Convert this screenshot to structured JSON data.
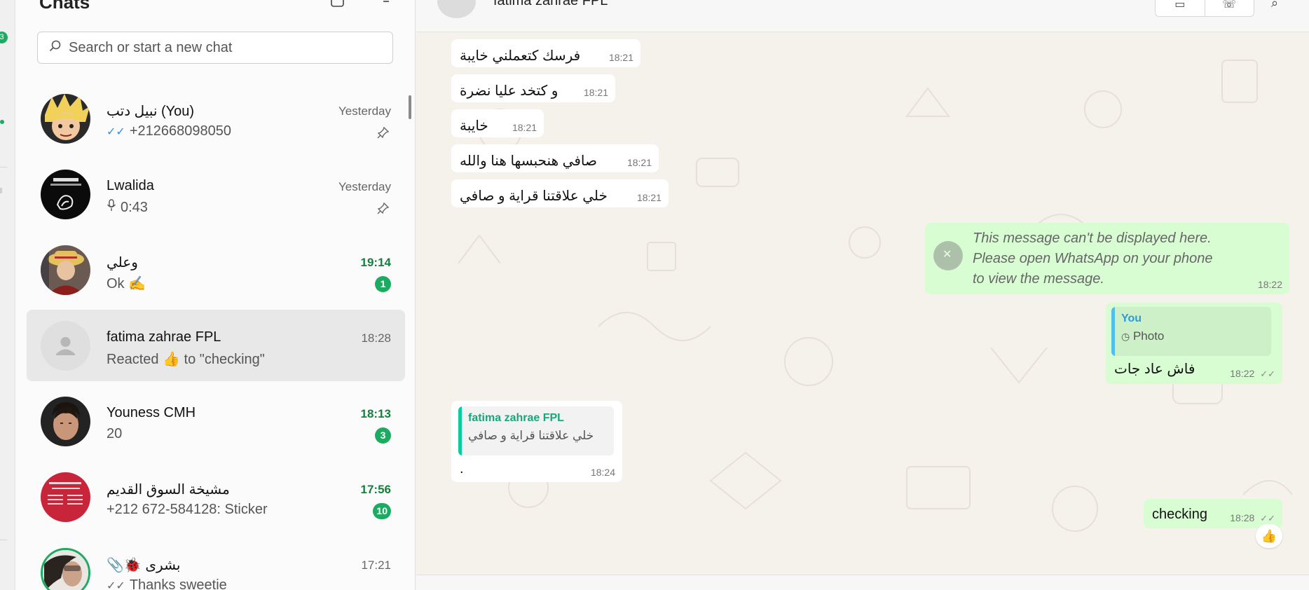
{
  "rail": {
    "badge": "3"
  },
  "sidebar": {
    "title": "Chats",
    "search": {
      "placeholder": "Search or start a new chat",
      "value": ""
    },
    "chats": [
      {
        "name": "نبيل دتب (You)",
        "preview": "+212668098050",
        "time": "Yesterday",
        "pinned": true,
        "status": "read-ticks",
        "avatar": "avatar-anime"
      },
      {
        "name": "Lwalida",
        "preview": "0:43",
        "time": "Yesterday",
        "pinned": true,
        "status": "voice-note",
        "avatar": "avatar-dark"
      },
      {
        "name": "وعلي",
        "preview": "Ok ✍️",
        "time": "19:14",
        "unread": "1",
        "avatar": "avatar-pirate"
      },
      {
        "name": "fatima zahrae FPL",
        "preview": "Reacted 👍 to \"checking\"",
        "time": "18:28",
        "selected": true,
        "avatar": "avatar-default"
      },
      {
        "name": "Youness CMH",
        "preview": "20",
        "time": "18:13",
        "unread": "3",
        "avatar": "avatar-man"
      },
      {
        "name": "مشيخة السوق القديم",
        "preview": "+212 672-584128: Sticker",
        "time": "17:56",
        "unread": "10",
        "avatar": "avatar-red"
      },
      {
        "name": "📎🐞 بشرى",
        "preview": "Thanks sweetie",
        "time": "17:21",
        "avatar": "avatar-status"
      }
    ]
  },
  "conversation": {
    "contact_name": "fatima zahrae FPL",
    "messages": [
      {
        "dir": "in",
        "text": "فرسك كتعملني خايبة",
        "time": "18:21"
      },
      {
        "dir": "in",
        "text": "و كتخد عليا نضرة",
        "time": "18:21"
      },
      {
        "dir": "in",
        "text": "خايبة",
        "time": "18:21"
      },
      {
        "dir": "in",
        "text": "صافي هنحبسها هنا والله",
        "time": "18:21"
      },
      {
        "dir": "in",
        "text": "خلي علاقتنا قراية و صافي",
        "time": "18:21"
      },
      {
        "dir": "out",
        "type": "unsupported",
        "text": "This message can't be displayed here. Please open WhatsApp on your phone to view the message.",
        "time": "18:22"
      },
      {
        "dir": "out",
        "quote_author": "You",
        "quote_text": "Photo",
        "text": "فاش عاد جات",
        "time": "18:22",
        "ticks": "✓✓"
      },
      {
        "dir": "in",
        "quote_author": "fatima zahrae FPL",
        "quote_text": "خلي علاقتنا قراية و صافي",
        "text": ".",
        "time": "18:24"
      },
      {
        "dir": "out",
        "text": "checking",
        "time": "18:28",
        "ticks": "✓✓",
        "reaction": "👍"
      }
    ]
  },
  "colors": {
    "accent": "#1daa61",
    "outgoing": "#d9fdd3",
    "incoming": "#ffffff",
    "quote_in": "#06cf9c",
    "quote_out": "#53bdeb"
  }
}
